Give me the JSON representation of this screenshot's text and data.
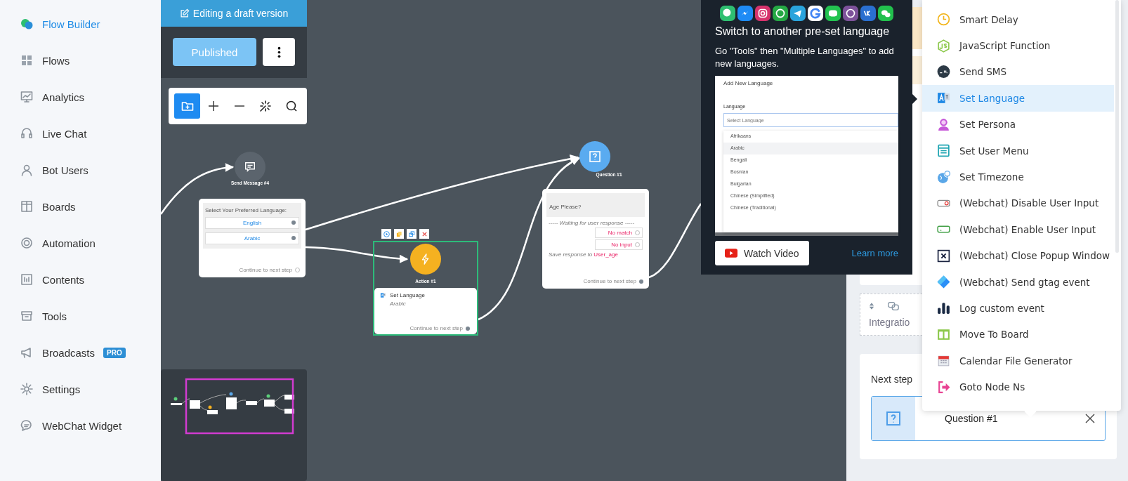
{
  "sidebar": {
    "items": [
      {
        "label": "Flow Builder",
        "kind": "brand",
        "selected": true
      },
      {
        "label": "Flows",
        "kind": "grid",
        "selected": false
      },
      {
        "label": "Analytics",
        "kind": "chart",
        "selected": false
      },
      {
        "label": "Live Chat",
        "kind": "headset",
        "selected": false
      },
      {
        "label": "Bot Users",
        "kind": "user",
        "selected": false
      },
      {
        "label": "Boards",
        "kind": "columns",
        "selected": false
      },
      {
        "label": "Automation",
        "kind": "ring",
        "selected": false
      },
      {
        "label": "Contents",
        "kind": "panel",
        "selected": false
      },
      {
        "label": "Tools",
        "kind": "box",
        "selected": false
      },
      {
        "label": "Broadcasts",
        "kind": "megaphone",
        "selected": false,
        "badge": "PRO"
      },
      {
        "label": "Settings",
        "kind": "gear",
        "selected": false
      },
      {
        "label": "WebChat Widget",
        "kind": "bubble",
        "selected": false
      }
    ]
  },
  "editor": {
    "banner": "Editing a draft version",
    "publish_button": "Published",
    "tools": [
      {
        "kind": "folder-plus",
        "selected": true
      },
      {
        "kind": "plus",
        "selected": false
      },
      {
        "kind": "minus",
        "selected": false
      },
      {
        "kind": "sparkle",
        "selected": false
      },
      {
        "kind": "search",
        "selected": false
      }
    ]
  },
  "canvas": {
    "nodes": [
      {
        "kind": "message",
        "title": "Send Message #4",
        "prompt": "Select Your Preferred Language:",
        "buttons": [
          "English",
          "Arabic"
        ],
        "continue": "Continue to next step"
      },
      {
        "kind": "action",
        "title": "Action #1",
        "step": "Set Language",
        "value": "Arabic",
        "continue": "Continue to next step",
        "selected": true
      },
      {
        "kind": "question",
        "title": "Question #1",
        "prompt": "Age Please?",
        "waiting": "----- Waiting for user response -----",
        "outputs": [
          "No match",
          "No input"
        ],
        "save_text": "Save response to",
        "save_variable": "User_age",
        "continue": "Continue to next step"
      }
    ]
  },
  "tooltip": {
    "title": "Switch to another pre-set language",
    "description": "Go \"Tools\" then \"Multiple Languages\" to add new languages.",
    "preview": {
      "heading": "Add New Language",
      "label": "Language",
      "placeholder": "Select Language",
      "options": [
        {
          "label": "Afrikaans",
          "selected": false
        },
        {
          "label": "Arabic",
          "selected": true
        },
        {
          "label": "Bengali",
          "selected": false
        },
        {
          "label": "Bosnian",
          "selected": false
        },
        {
          "label": "Bulgarian",
          "selected": false
        },
        {
          "label": "Chinese (Simplified)",
          "selected": false
        },
        {
          "label": "Chinese (Traditional)",
          "selected": false
        }
      ]
    },
    "video_button": "Watch Video",
    "link": "Learn more"
  },
  "menu": {
    "items": [
      {
        "label": "Smart Delay",
        "kind": "clock",
        "selected": false
      },
      {
        "label": "JavaScript Function",
        "kind": "js",
        "selected": false
      },
      {
        "label": "Send SMS",
        "kind": "sms",
        "selected": false
      },
      {
        "label": "Set Language",
        "kind": "translate",
        "selected": true
      },
      {
        "label": "Set Persona",
        "kind": "persona",
        "selected": false
      },
      {
        "label": "Set User Menu",
        "kind": "menu",
        "selected": false
      },
      {
        "label": "Set Timezone",
        "kind": "globe",
        "selected": false
      },
      {
        "label": "(Webchat) Disable User Input",
        "kind": "input-off",
        "selected": false
      },
      {
        "label": "(Webchat) Enable User Input",
        "kind": "input-on",
        "selected": false
      },
      {
        "label": "(Webchat) Close Popup Window",
        "kind": "close-box",
        "selected": false
      },
      {
        "label": "(Webchat) Send gtag event",
        "kind": "diamond",
        "selected": false
      },
      {
        "label": "Log custom event",
        "kind": "bars",
        "selected": false
      },
      {
        "label": "Move To Board",
        "kind": "board",
        "selected": false
      },
      {
        "label": "Calendar File Generator",
        "kind": "calendar",
        "selected": false
      },
      {
        "label": "Goto Node Ns",
        "kind": "goto",
        "selected": false
      }
    ]
  },
  "panel": {
    "integration_label": "Integratio",
    "next_step_label": "Next step",
    "next_step": "Question #1"
  }
}
